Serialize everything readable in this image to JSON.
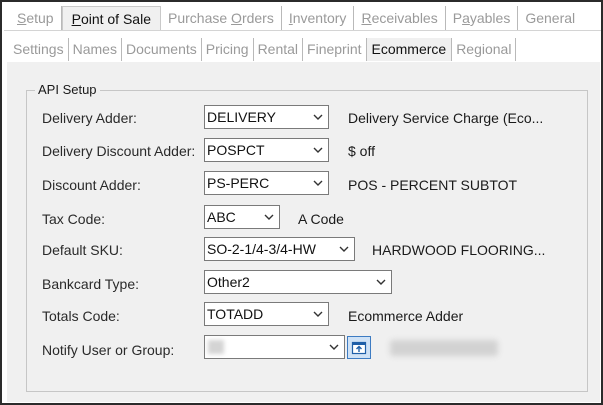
{
  "primary_tabs": [
    {
      "pre": "",
      "ul": "S",
      "post": "etup"
    },
    {
      "pre": "",
      "ul": "P",
      "post": "oint of Sale"
    },
    {
      "pre": "Purchase ",
      "ul": "O",
      "post": "rders"
    },
    {
      "pre": "",
      "ul": "I",
      "post": "nventory"
    },
    {
      "pre": "",
      "ul": "R",
      "post": "eceivables"
    },
    {
      "pre": "P",
      "ul": "a",
      "post": "yables"
    },
    {
      "pre": "General",
      "ul": "",
      "post": ""
    }
  ],
  "secondary_tabs": [
    "Settings",
    "Names",
    "Documents",
    "Pricing",
    "Rental",
    "Fineprint",
    "Ecommerce",
    "Regional"
  ],
  "group_title": "API Setup",
  "fields": {
    "delivery_adder": {
      "label": "Delivery Adder:",
      "value": "DELIVERY",
      "description": "Delivery Service Charge (Eco..."
    },
    "delivery_discount_adder": {
      "label": "Delivery Discount Adder:",
      "value": "POSPCT",
      "description": "$ off"
    },
    "discount_adder": {
      "label": "Discount Adder:",
      "value": "PS-PERC",
      "description": "POS - PERCENT SUBTOT"
    },
    "tax_code": {
      "label": "Tax Code:",
      "value": "ABC",
      "description": "A Code"
    },
    "default_sku": {
      "label": "Default SKU:",
      "value": "SO-2-1/4-3/4-HW",
      "description": "HARDWOOD FLOORING..."
    },
    "bankcard_type": {
      "label": "Bankcard Type:",
      "value": "Other2"
    },
    "totals_code": {
      "label": "Totals Code:",
      "value": "TOTADD",
      "description": "Ecommerce Adder"
    },
    "notify_user": {
      "label": "Notify User or Group:",
      "value": ""
    }
  },
  "icons": {
    "dropdown": "chevron-down-icon",
    "lookup": "lookup-icon"
  },
  "colors": {
    "content_bg": "#f0f0f0",
    "lookup_button": "#cfe2f6",
    "lookup_border": "#3d7bc2"
  }
}
